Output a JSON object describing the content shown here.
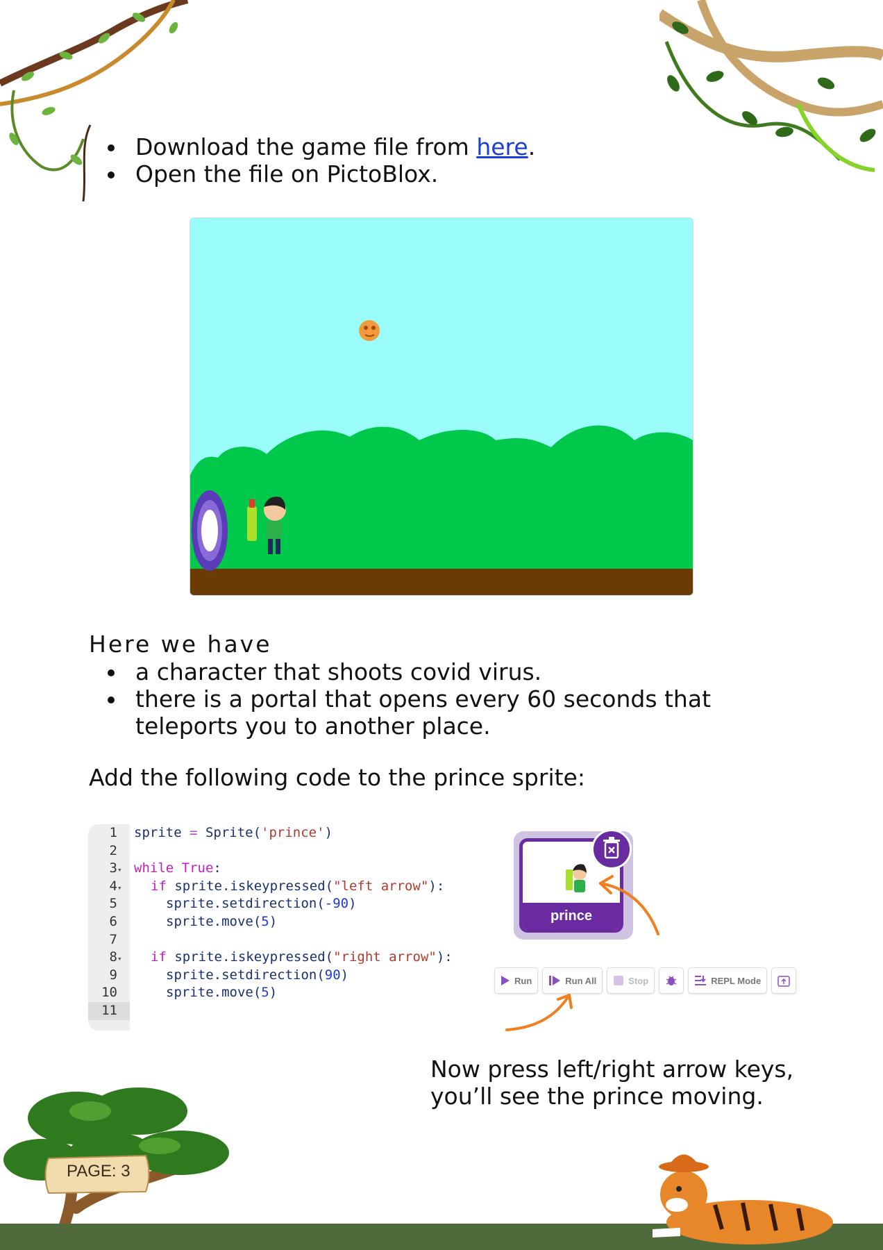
{
  "intro": {
    "bullet1_prefix": "Download the game file from ",
    "bullet1_link": "here",
    "bullet1_suffix": ".",
    "bullet2": "Open the file on PictoBlox."
  },
  "here_heading": "Here we have",
  "facts": [
    "a character that shoots covid virus.",
    "there is a portal that opens every 60 seconds that teleports you to another place."
  ],
  "add_code_text": "Add the following code to the prince sprite:",
  "code": {
    "line_numbers": [
      "1",
      "2",
      "3",
      "4",
      "5",
      "6",
      "7",
      "8",
      "9",
      "10",
      "11"
    ],
    "l1": {
      "a": "sprite ",
      "b": "=",
      "c": " Sprite(",
      "d": "'prince'",
      "e": ")"
    },
    "l3": {
      "a": "while",
      "b": " ",
      "c": "True",
      "d": ":"
    },
    "l4": {
      "a": "if",
      "b": " sprite.iskeypressed(",
      "c": "\"left arrow\"",
      "d": "):"
    },
    "l5": {
      "a": "sprite.setdirection(",
      "b": "-90",
      "c": ")"
    },
    "l6": {
      "a": "sprite.move(",
      "b": "5",
      "c": ")"
    },
    "l8": {
      "a": "if",
      "b": " sprite.iskeypressed(",
      "c": "\"right arrow\"",
      "d": "):"
    },
    "l9": {
      "a": "sprite.setdirection(",
      "b": "90",
      "c": ")"
    },
    "l10": {
      "a": "sprite.move(",
      "b": "5",
      "c": ")"
    }
  },
  "sprite_card": {
    "name": "prince",
    "delete_icon": "trash-icon"
  },
  "toolbar": {
    "run": "Run",
    "run_all": "Run All",
    "stop": "Stop",
    "repl": "REPL Mode"
  },
  "instruction": "Now press left/right arrow keys, you’ll see the prince moving.",
  "page_label": "PAGE: 3",
  "colors": {
    "accent_purple": "#6a2aa0",
    "arrow_orange": "#f07f22",
    "sky": "#9bfdfa",
    "hills": "#00c84a",
    "ground": "#6b3b06"
  }
}
